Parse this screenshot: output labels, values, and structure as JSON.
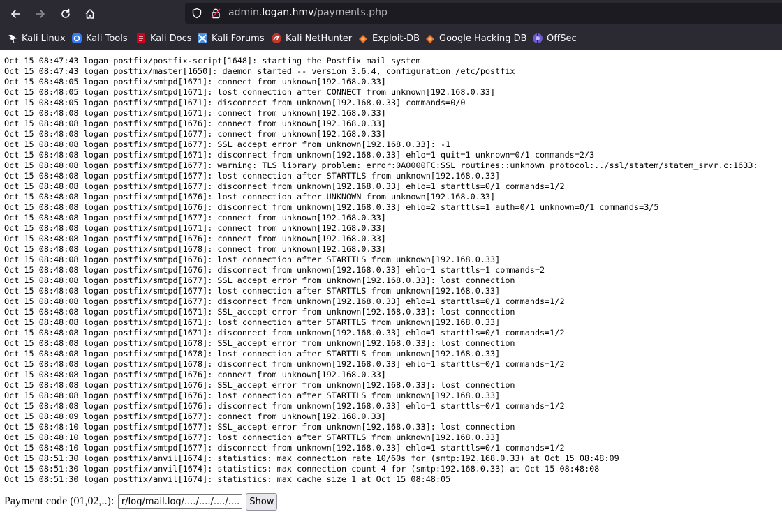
{
  "browser": {
    "url_prefix": "admin.",
    "url_host": "logan.hmv",
    "url_path": "/payments.php"
  },
  "bookmarks": [
    {
      "label": "Kali Linux",
      "icon": "kali-dragon-icon"
    },
    {
      "label": "Kali Tools",
      "icon": "kali-tools-icon"
    },
    {
      "label": "Kali Docs",
      "icon": "kali-docs-icon"
    },
    {
      "label": "Kali Forums",
      "icon": "kali-forums-icon"
    },
    {
      "label": "Kali NetHunter",
      "icon": "kali-nethunter-icon"
    },
    {
      "label": "Exploit-DB",
      "icon": "exploit-db-icon"
    },
    {
      "label": "Google Hacking DB",
      "icon": "ghdb-icon"
    },
    {
      "label": "OffSec",
      "icon": "offsec-icon"
    }
  ],
  "log_lines": [
    "Oct 15 08:47:43 logan postfix/postfix-script[1648]: starting the Postfix mail system",
    "Oct 15 08:47:43 logan postfix/master[1650]: daemon started -- version 3.6.4, configuration /etc/postfix",
    "Oct 15 08:48:05 logan postfix/smtpd[1671]: connect from unknown[192.168.0.33]",
    "Oct 15 08:48:05 logan postfix/smtpd[1671]: lost connection after CONNECT from unknown[192.168.0.33]",
    "Oct 15 08:48:05 logan postfix/smtpd[1671]: disconnect from unknown[192.168.0.33] commands=0/0",
    "Oct 15 08:48:08 logan postfix/smtpd[1671]: connect from unknown[192.168.0.33]",
    "Oct 15 08:48:08 logan postfix/smtpd[1676]: connect from unknown[192.168.0.33]",
    "Oct 15 08:48:08 logan postfix/smtpd[1677]: connect from unknown[192.168.0.33]",
    "Oct 15 08:48:08 logan postfix/smtpd[1677]: SSL_accept error from unknown[192.168.0.33]: -1",
    "Oct 15 08:48:08 logan postfix/smtpd[1671]: disconnect from unknown[192.168.0.33] ehlo=1 quit=1 unknown=0/1 commands=2/3",
    "Oct 15 08:48:08 logan postfix/smtpd[1677]: warning: TLS library problem: error:0A0000FC:SSL routines::unknown protocol:../ssl/statem/statem_srvr.c:1633:",
    "Oct 15 08:48:08 logan postfix/smtpd[1677]: lost connection after STARTTLS from unknown[192.168.0.33]",
    "Oct 15 08:48:08 logan postfix/smtpd[1677]: disconnect from unknown[192.168.0.33] ehlo=1 starttls=0/1 commands=1/2",
    "Oct 15 08:48:08 logan postfix/smtpd[1676]: lost connection after UNKNOWN from unknown[192.168.0.33]",
    "Oct 15 08:48:08 logan postfix/smtpd[1676]: disconnect from unknown[192.168.0.33] ehlo=2 starttls=1 auth=0/1 unknown=0/1 commands=3/5",
    "Oct 15 08:48:08 logan postfix/smtpd[1677]: connect from unknown[192.168.0.33]",
    "Oct 15 08:48:08 logan postfix/smtpd[1671]: connect from unknown[192.168.0.33]",
    "Oct 15 08:48:08 logan postfix/smtpd[1676]: connect from unknown[192.168.0.33]",
    "Oct 15 08:48:08 logan postfix/smtpd[1678]: connect from unknown[192.168.0.33]",
    "Oct 15 08:48:08 logan postfix/smtpd[1676]: lost connection after STARTTLS from unknown[192.168.0.33]",
    "Oct 15 08:48:08 logan postfix/smtpd[1676]: disconnect from unknown[192.168.0.33] ehlo=1 starttls=1 commands=2",
    "Oct 15 08:48:08 logan postfix/smtpd[1677]: SSL_accept error from unknown[192.168.0.33]: lost connection",
    "Oct 15 08:48:08 logan postfix/smtpd[1677]: lost connection after STARTTLS from unknown[192.168.0.33]",
    "Oct 15 08:48:08 logan postfix/smtpd[1677]: disconnect from unknown[192.168.0.33] ehlo=1 starttls=0/1 commands=1/2",
    "Oct 15 08:48:08 logan postfix/smtpd[1671]: SSL_accept error from unknown[192.168.0.33]: lost connection",
    "Oct 15 08:48:08 logan postfix/smtpd[1671]: lost connection after STARTTLS from unknown[192.168.0.33]",
    "Oct 15 08:48:08 logan postfix/smtpd[1671]: disconnect from unknown[192.168.0.33] ehlo=1 starttls=0/1 commands=1/2",
    "Oct 15 08:48:08 logan postfix/smtpd[1678]: SSL_accept error from unknown[192.168.0.33]: lost connection",
    "Oct 15 08:48:08 logan postfix/smtpd[1678]: lost connection after STARTTLS from unknown[192.168.0.33]",
    "Oct 15 08:48:08 logan postfix/smtpd[1678]: disconnect from unknown[192.168.0.33] ehlo=1 starttls=0/1 commands=1/2",
    "Oct 15 08:48:08 logan postfix/smtpd[1676]: connect from unknown[192.168.0.33]",
    "Oct 15 08:48:08 logan postfix/smtpd[1676]: SSL_accept error from unknown[192.168.0.33]: lost connection",
    "Oct 15 08:48:08 logan postfix/smtpd[1676]: lost connection after STARTTLS from unknown[192.168.0.33]",
    "Oct 15 08:48:08 logan postfix/smtpd[1676]: disconnect from unknown[192.168.0.33] ehlo=1 starttls=0/1 commands=1/2",
    "Oct 15 08:48:09 logan postfix/smtpd[1677]: connect from unknown[192.168.0.33]",
    "Oct 15 08:48:10 logan postfix/smtpd[1677]: SSL_accept error from unknown[192.168.0.33]: lost connection",
    "Oct 15 08:48:10 logan postfix/smtpd[1677]: lost connection after STARTTLS from unknown[192.168.0.33]",
    "Oct 15 08:48:10 logan postfix/smtpd[1677]: disconnect from unknown[192.168.0.33] ehlo=1 starttls=0/1 commands=1/2",
    "Oct 15 08:51:30 logan postfix/anvil[1674]: statistics: max connection rate 10/60s for (smtp:192.168.0.33) at Oct 15 08:48:09",
    "Oct 15 08:51:30 logan postfix/anvil[1674]: statistics: max connection count 4 for (smtp:192.168.0.33) at Oct 15 08:48:08",
    "Oct 15 08:51:30 logan postfix/anvil[1674]: statistics: max cache size 1 at Oct 15 08:48:05"
  ],
  "form": {
    "label": "Payment code (01,02,..):",
    "input_value": "..../..../..../..../var/log/mail.log",
    "button_label": "Show"
  },
  "colors": {
    "chrome_bg": "#2b2a33",
    "urlbar_bg": "#1c1b22",
    "page_bg": "#ffffff"
  }
}
